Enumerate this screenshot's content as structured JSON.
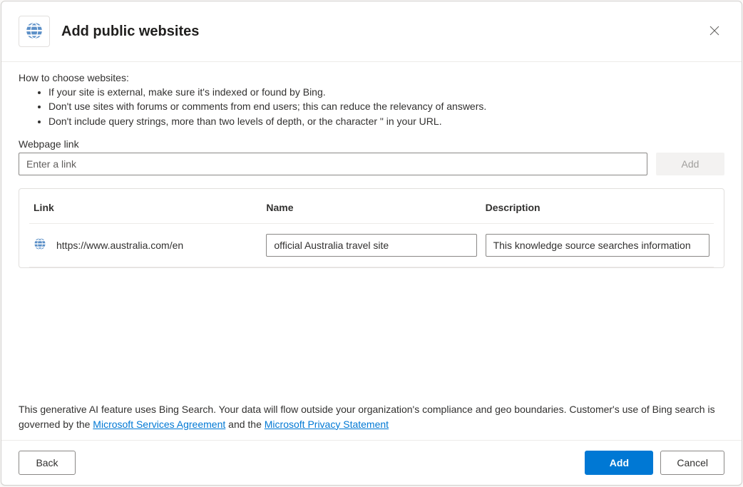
{
  "header": {
    "title": "Add public websites"
  },
  "instructions": {
    "heading": "How to choose websites:",
    "items": [
      "If your site is external, make sure it's indexed or found by Bing.",
      "Don't use sites with forums or comments from end users; this can reduce the relevancy of answers.",
      "Don't include query strings, more than two levels of depth, or the character \" in your URL."
    ]
  },
  "webpageLink": {
    "label": "Webpage link",
    "placeholder": "Enter a link",
    "addButton": "Add"
  },
  "table": {
    "columns": {
      "link": "Link",
      "name": "Name",
      "description": "Description"
    },
    "rows": [
      {
        "link": "https://www.australia.com/en",
        "name": "official Australia travel site",
        "description": "This knowledge source searches information"
      }
    ]
  },
  "disclaimer": {
    "prefix": "This generative AI feature uses Bing Search. Your data will flow outside your organization's compliance and geo boundaries. Customer's use of Bing search is governed by the ",
    "link1": "Microsoft Services Agreement",
    "mid": " and the ",
    "link2": "Microsoft Privacy Statement"
  },
  "footer": {
    "back": "Back",
    "add": "Add",
    "cancel": "Cancel"
  }
}
